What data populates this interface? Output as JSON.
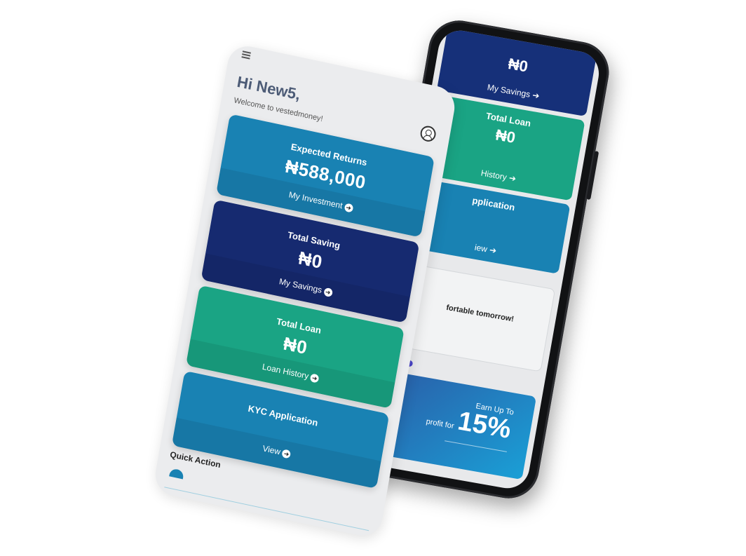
{
  "back_phone": {
    "savings_value": "₦0",
    "savings_link": "My Savings",
    "loan_title": "Total Loan",
    "loan_value": "₦0",
    "loan_link": "History",
    "kyc_title": "pplication",
    "kyc_link": "iew",
    "notice_text": "fortable tomorrow!",
    "promo_lead": "profit for",
    "promo_earn": "Earn Up To",
    "promo_value": "15%"
  },
  "front_phone": {
    "greeting": "Hi New5,",
    "welcome": "Welcome to vestedmoney!",
    "cards": [
      {
        "title": "Expected Returns",
        "value": "₦588,000",
        "link": "My Investment"
      },
      {
        "title": "Total Saving",
        "value": "₦0",
        "link": "My Savings"
      },
      {
        "title": "Total Loan",
        "value": "₦0",
        "link": "Loan History"
      },
      {
        "title": "KYC Application",
        "link": "View"
      }
    ],
    "quick_action": "Quick Action"
  },
  "colors": {
    "primary_blue": "#1982b3",
    "navy": "#162a70",
    "teal": "#1aa484"
  },
  "icons": {
    "arrow": "circle-arrow-right-icon",
    "menu": "hamburger-menu-icon",
    "profile": "user-circle-icon"
  }
}
